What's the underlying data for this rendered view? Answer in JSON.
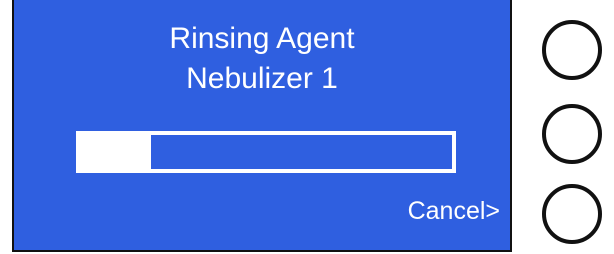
{
  "screen": {
    "title_line1": "Rinsing Agent",
    "title_line2": "Nebulizer 1",
    "progress_fraction": 0.19,
    "cancel_label": "Cancel>"
  },
  "colors": {
    "screen_background": "#2f5fe0",
    "text": "#ffffff",
    "bezel": "#111111"
  },
  "side_buttons": [
    {
      "id": "top"
    },
    {
      "id": "middle"
    },
    {
      "id": "bottom"
    }
  ]
}
